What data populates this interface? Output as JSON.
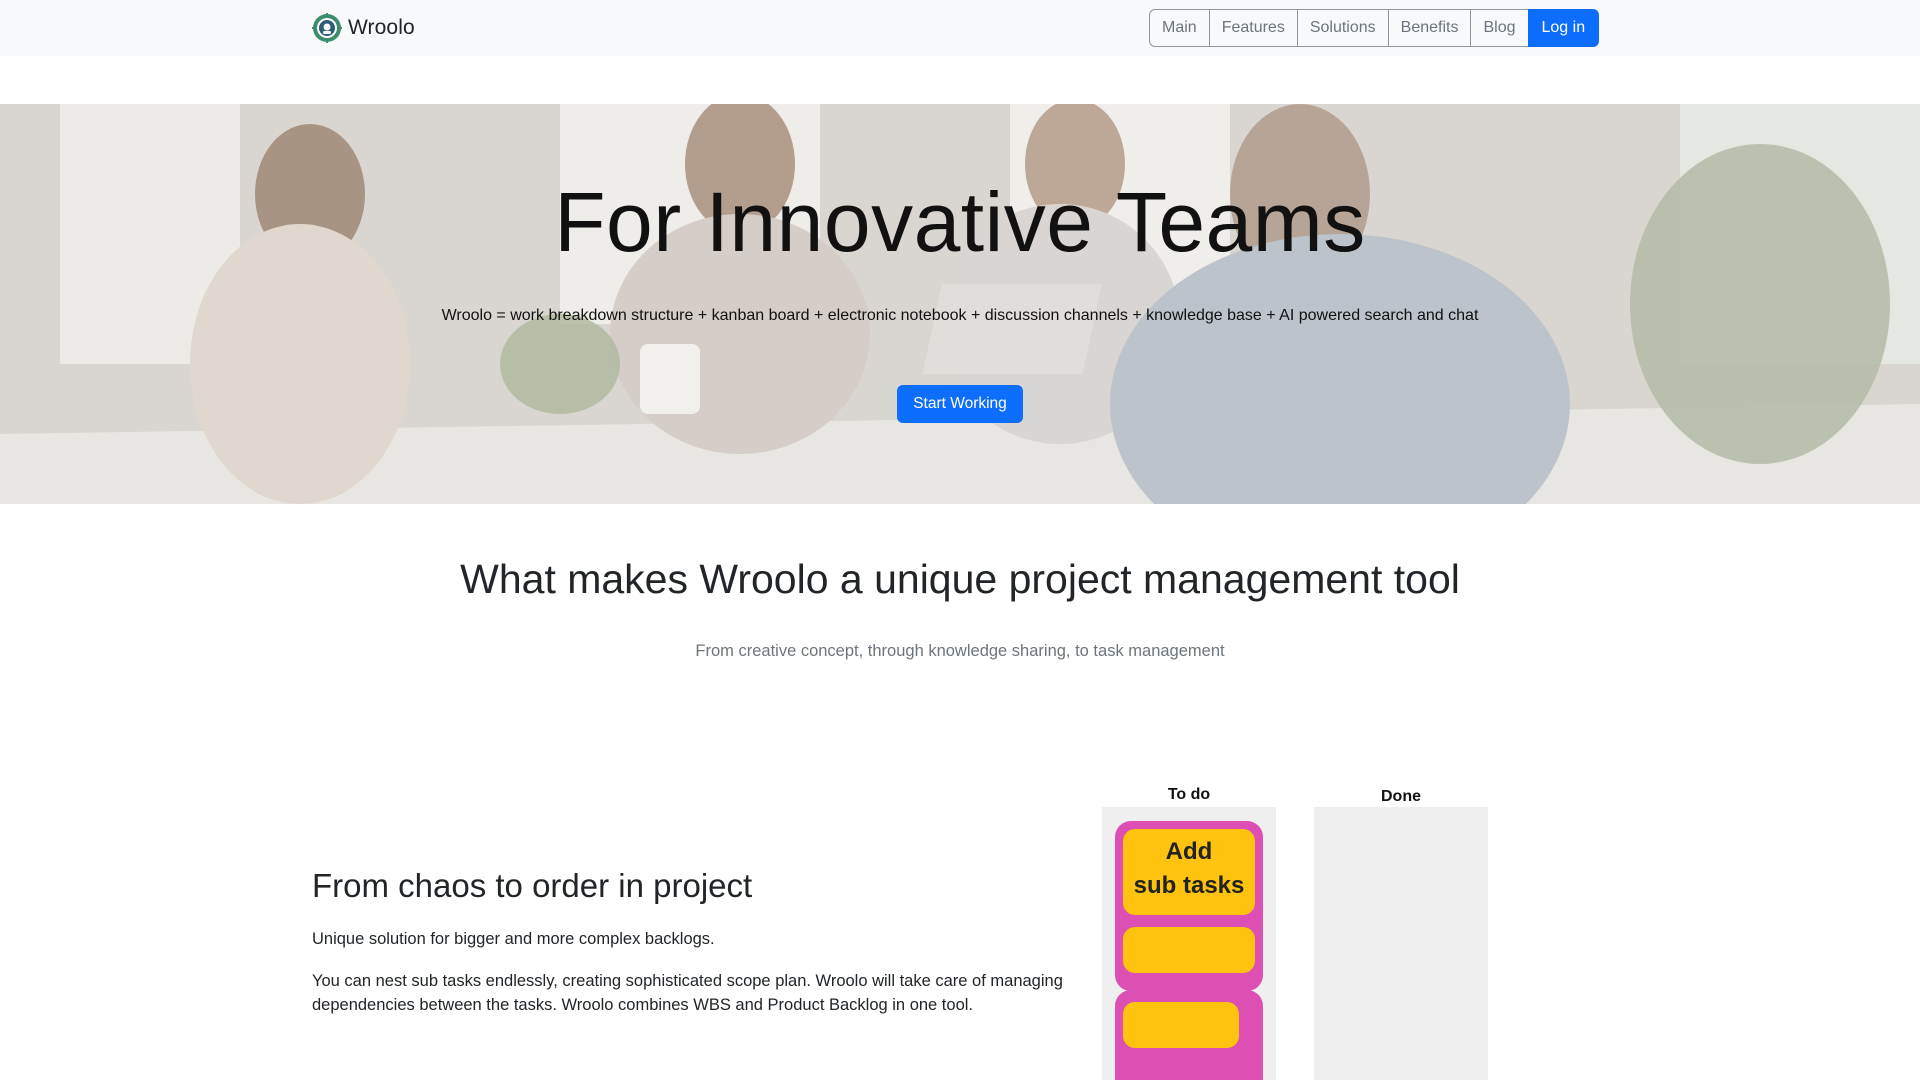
{
  "brand": {
    "name": "Wroolo",
    "logo_icon": "gear-logo-icon"
  },
  "nav": {
    "items": [
      {
        "label": "Main"
      },
      {
        "label": "Features"
      },
      {
        "label": "Solutions"
      },
      {
        "label": "Benefits"
      },
      {
        "label": "Blog"
      }
    ],
    "login_label": "Log in"
  },
  "hero": {
    "title": "For Innovative Teams",
    "subtitle": "Wroolo = work breakdown structure + kanban board + electronic notebook + discussion channels + knowledge base + AI powered search and chat",
    "cta_label": "Start Working"
  },
  "section": {
    "title": "What makes Wroolo a unique project management tool",
    "subtitle": "From creative concept, through knowledge sharing, to task management"
  },
  "feature": {
    "title": "From chaos to order in project",
    "p1": "Unique solution for bigger and more complex backlogs.",
    "p2": "You can nest sub tasks endlessly, creating sophisticated scope plan. Wroolo will take care of managing dependencies between the tasks. Wroolo combines WBS and Product Backlog in one tool."
  },
  "kanban": {
    "todo_label": "To do",
    "done_label": "Done",
    "card_text_line1": "Add",
    "card_text_line2": "sub tasks"
  },
  "colors": {
    "primary": "#0d6efd",
    "navbar_bg": "#f8f9fa",
    "kanban_group": "#dd4fb3",
    "kanban_card": "#fdc30e",
    "kanban_column": "#efefef"
  }
}
